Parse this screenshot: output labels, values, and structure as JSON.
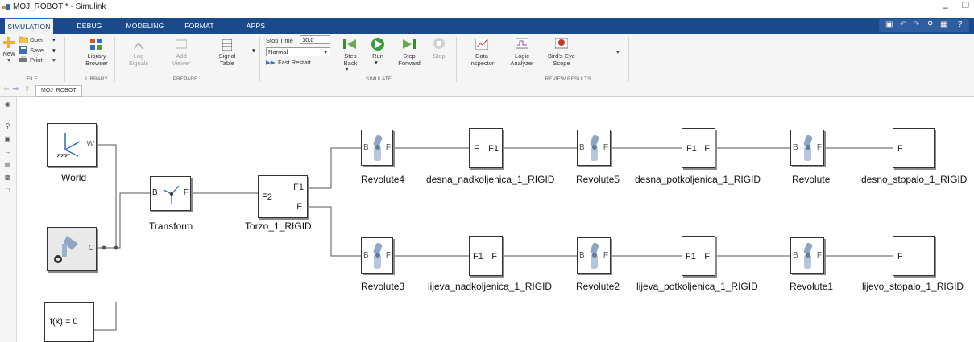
{
  "window": {
    "title": "MOJ_ROBOT * - Simulink"
  },
  "tabs": [
    "SIMULATION",
    "DEBUG",
    "MODELING",
    "FORMAT",
    "APPS"
  ],
  "ribbon": {
    "file": {
      "new": "New",
      "open": "Open",
      "save": "Save",
      "print": "Print",
      "group": "FILE"
    },
    "library": {
      "browser": "Library\nBrowser",
      "group": "LIBRARY"
    },
    "prepare": {
      "log_signals": "Log\nSignals",
      "add_viewer": "Add\nViewer",
      "signal_table": "Signal\nTable",
      "group": "PREPARE"
    },
    "simulate": {
      "stop_time_label": "Stop Time",
      "stop_time_value": "10.0",
      "mode": "Normal",
      "fast_restart": "Fast Restart",
      "step_back": "Step\nBack",
      "run": "Run",
      "step_forward": "Step\nForward",
      "stop": "Stop",
      "group": "SIMULATE"
    },
    "review": {
      "data_inspector": "Data\nInspector",
      "logic_analyzer": "Logic\nAnalyzer",
      "birds_eye": "Bird's-Eye\nScope",
      "group": "REVIEW RESULTS"
    }
  },
  "breadcrumb": "MOJ_ROBOT",
  "blocks": {
    "world": {
      "label": "World",
      "port": "W"
    },
    "solver": {
      "port": "C"
    },
    "fx": {
      "text": "f(x) = 0"
    },
    "transform": {
      "label": "Transform",
      "port_b": "B",
      "port_f": "F"
    },
    "torzo": {
      "label": "Torzo_1_RIGID",
      "p1": "F1",
      "p2": "F2",
      "p3": "F"
    },
    "rev4": {
      "label": "Revolute4"
    },
    "desna_nad": {
      "label": "desna_nadkoljenica_1_RIGID",
      "pin": "F",
      "pout": "F1"
    },
    "rev5": {
      "label": "Revolute5"
    },
    "desna_pot": {
      "label": "desna_potkoljenica_1_RIGID",
      "pin": "F1",
      "pout": "F"
    },
    "rev": {
      "label": "Revolute"
    },
    "desno_stop": {
      "label": "desno_stopalo_1_RIGID",
      "pin": "F"
    },
    "rev3": {
      "label": "Revolute3"
    },
    "lijeva_nad": {
      "label": "lijeva_nadkoljenica_1_RIGID",
      "pin": "F1",
      "pout": "F"
    },
    "rev2": {
      "label": "Revolute2"
    },
    "lijeva_pot": {
      "label": "lijeva_potkoljenica_1_RIGID",
      "pin": "F1",
      "pout": "F"
    },
    "rev1": {
      "label": "Revolute1"
    },
    "lijevo_stop": {
      "label": "lijevo_stopalo_1_RIGID",
      "pin": "F"
    },
    "joint_ports": {
      "b": "B",
      "f": "F"
    }
  }
}
